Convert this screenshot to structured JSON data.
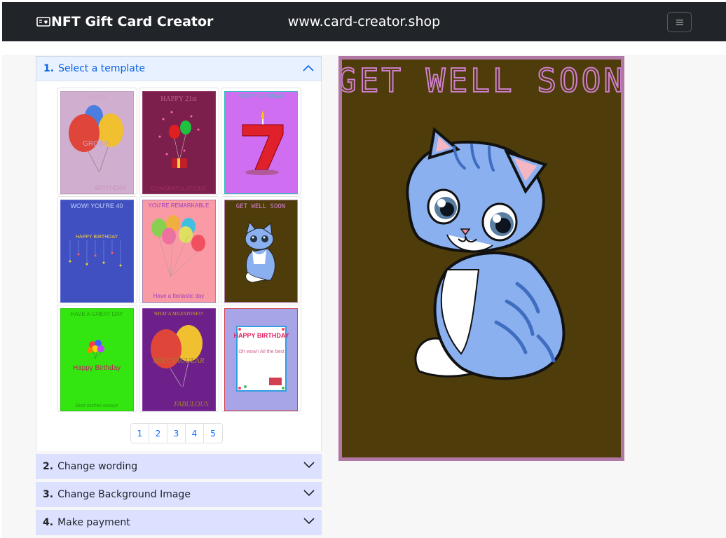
{
  "navbar": {
    "brand": "NFT Gift Card Creator",
    "brand_icon": "card-heart-icon",
    "site_url": "www.card-creator.shop",
    "toggler_icon": "hamburger-menu-icon"
  },
  "accordion": {
    "sections": [
      {
        "number": "1.",
        "label": "Select a template",
        "expanded": true
      },
      {
        "number": "2.",
        "label": "Change wording",
        "expanded": false
      },
      {
        "number": "3.",
        "label": "Change Background Image",
        "expanded": false
      },
      {
        "number": "4.",
        "label": "Make payment",
        "expanded": false
      }
    ],
    "chevron_up_icon": "chevron-up-icon",
    "chevron_down_icon": "chevron-down-icon"
  },
  "templates": [
    {
      "top_text": "HAPPY",
      "mid_text": "GROWN",
      "bottom_text": "BIRTHDAY",
      "bg": "#d0aecf",
      "image": "balloons"
    },
    {
      "top_text": "HAPPY 21st",
      "mid_text": "",
      "bottom_text": "CONGRATULATIONS",
      "bg": "#7c1f4c",
      "image": "champagne-balloons"
    },
    {
      "top_text": "HAPPY BIRTHDAY",
      "mid_text": "",
      "bottom_text": "",
      "bg": "#cf6ef0",
      "image": "birthday-candle-7"
    },
    {
      "top_text": "WOW! YOU'RE 40",
      "mid_text": "HAPPY BIRTHDAY",
      "bottom_text": "",
      "bg": "#4050c0",
      "image": "hanging-stars"
    },
    {
      "top_text": "YOU'RE REMARKABLE",
      "mid_text": "",
      "bottom_text": "Have a fantastic day",
      "bg": "#f99aa4",
      "image": "colorful-balloons"
    },
    {
      "top_text": "GET WELL SOON",
      "mid_text": "",
      "bottom_text": "",
      "bg": "#4e3c0b",
      "image": "blue-kitten"
    },
    {
      "top_text": "HAVE A GREAT DAY",
      "mid_text": "Happy Birthday",
      "bottom_text": "Best wishes always",
      "bg": "#33e610",
      "image": "small-balloons"
    },
    {
      "top_text": "WHAT A MILESTONE!!!",
      "mid_text": "SPECTACULAR",
      "bottom_text": "FABULOUS",
      "bg": "#6d2089",
      "image": "balloons"
    },
    {
      "top_text": "HAPPY BIRTHDAY",
      "mid_text": "Oh wow!! All the best",
      "bottom_text": "",
      "bg": "#a7a4e8",
      "image": "birthday-card"
    }
  ],
  "pagination": {
    "pages": [
      "1",
      "2",
      "3",
      "4",
      "5"
    ]
  },
  "preview": {
    "title": "GET WELL SOON",
    "background_color": "#4e3c0b",
    "border_color": "#b278a5",
    "title_color": "#c46cc0",
    "image": "blue-kitten"
  }
}
